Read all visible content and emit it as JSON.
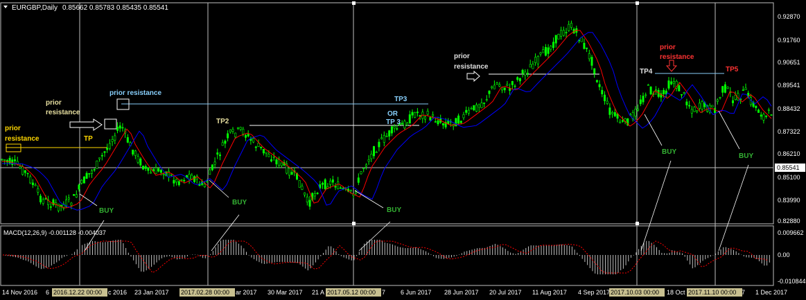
{
  "header": {
    "symbol": "EURGBP,Daily",
    "ohlc": "0.85662 0.85783 0.85435 0.85541"
  },
  "price_axis": {
    "labels": [
      "0.92870",
      "0.91760",
      "0.90651",
      "0.89541",
      "0.88432",
      "0.87322",
      "0.86210",
      "0.85100",
      "0.83990",
      "0.82880"
    ],
    "current_price": "0.85541"
  },
  "macd": {
    "title": "MACD(12,26,9) -0.001128 -0.004037",
    "labels": [
      "0.009662",
      "0.00",
      "-0.010844"
    ]
  },
  "time_axis": {
    "labels": [
      "14 Nov 2016",
      "6",
      "c 2016",
      "23 Jan 2017",
      "ar 2017",
      "30 Mar 2017",
      "21 A",
      "7",
      "6 Jun 2017",
      "28 Jun 2017",
      "20 Jul 2017",
      "11 Aug 2017",
      "4 Sep 2017",
      "18 Oct",
      "7",
      "1 Dec 2017"
    ],
    "highlighted": [
      "2016.12.22 00:00",
      "2017.02.28 00:00",
      "2017.05.12 00:00",
      "2017.10.03 00:00",
      "2017.11.10 00:00"
    ]
  },
  "annotations": {
    "prior_resistance_1": [
      "prior",
      "resistance"
    ],
    "prior_resistance_2": [
      "prior",
      "resistance"
    ],
    "prior_resistance_3": "prior resistance",
    "prior_resistance_4": [
      "prior",
      "resistance"
    ],
    "prior_resistance_5": [
      "prior",
      "resistance"
    ],
    "tp": "TP",
    "tp2": "TP2",
    "tp3": "TP3",
    "or": "OR",
    "tp3b": "TP 3",
    "tp4": "TP4",
    "tp5": "TP5",
    "buy": "BUY"
  },
  "colors": {
    "up": "#00ff00",
    "red": "#ff0000",
    "blue": "#0000ff",
    "yellow": "#ffd700",
    "lightblue": "#87cefa",
    "green": "#34b233",
    "red_label": "#ff3333",
    "grid": "#c0c0c0"
  }
}
